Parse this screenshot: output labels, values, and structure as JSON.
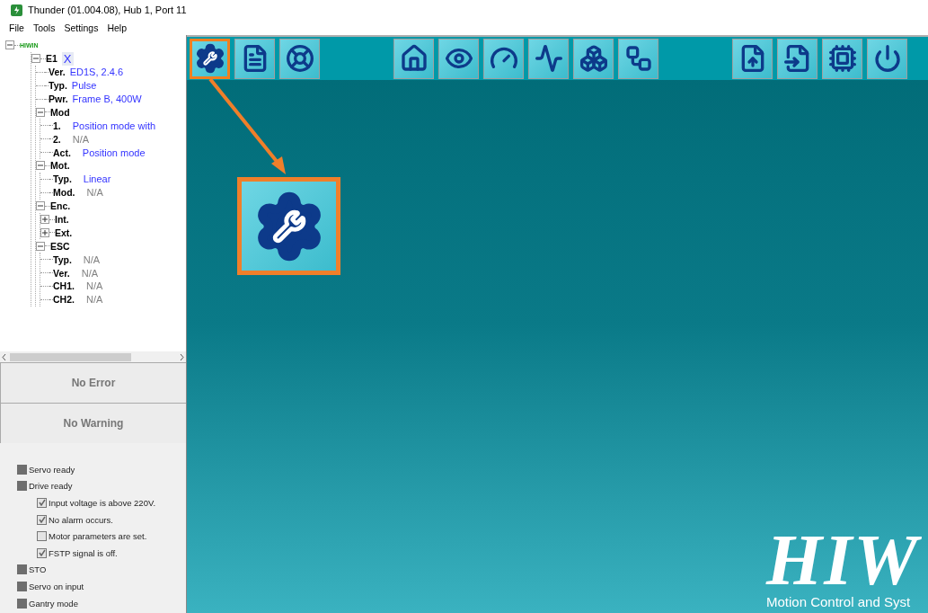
{
  "window": {
    "title": "Thunder (01.004.08), Hub 1, Port 11"
  },
  "menu": [
    "File",
    "Tools",
    "Settings",
    "Help"
  ],
  "tree": [
    {
      "label": "HIWIN",
      "kind": "root",
      "expanded": true,
      "children": [
        {
          "label": "E1",
          "value": "X",
          "color": "#3333ff",
          "expanded": true,
          "children": [
            {
              "label": "Ver.",
              "value": "ED1S, 2.4.6",
              "color": "#3333ff"
            },
            {
              "label": "Typ.",
              "value": "Pulse",
              "color": "#3333ff"
            },
            {
              "label": "Pwr.",
              "value": "Frame B, 400W",
              "color": "#3333ff"
            },
            {
              "label": "Mod",
              "expanded": true,
              "children": [
                {
                  "label": "1.",
                  "value": "Position mode with",
                  "color": "#3333ff"
                },
                {
                  "label": "2.",
                  "value": "N/A",
                  "color": "#808080"
                },
                {
                  "label": "Act.",
                  "value": "Position mode",
                  "color": "#3333ff"
                }
              ]
            },
            {
              "label": "Mot.",
              "expanded": true,
              "children": [
                {
                  "label": "Typ.",
                  "value": "Linear",
                  "color": "#3333ff"
                },
                {
                  "label": "Mod.",
                  "value": "N/A",
                  "color": "#808080"
                }
              ]
            },
            {
              "label": "Enc.",
              "expanded": true,
              "children": [
                {
                  "label": "Int.",
                  "expanded": false
                },
                {
                  "label": "Ext.",
                  "expanded": false
                }
              ]
            },
            {
              "label": "ESC",
              "expanded": true,
              "children": [
                {
                  "label": "Typ.",
                  "value": "N/A",
                  "color": "#808080"
                },
                {
                  "label": "Ver.",
                  "value": "N/A",
                  "color": "#808080"
                },
                {
                  "label": "CH1.",
                  "value": "N/A",
                  "color": "#808080"
                },
                {
                  "label": "CH2.",
                  "value": "N/A",
                  "color": "#808080"
                }
              ]
            }
          ]
        }
      ]
    }
  ],
  "error": "No Error",
  "warning": "No Warning",
  "status": [
    {
      "kind": "lamp",
      "label": "Servo ready",
      "on": false
    },
    {
      "kind": "lamp",
      "label": "Drive ready",
      "on": false
    },
    {
      "kind": "check",
      "label": "Input voltage is above 220V.",
      "checked": true
    },
    {
      "kind": "check",
      "label": "No alarm occurs.",
      "checked": true
    },
    {
      "kind": "check",
      "label": "Motor parameters are set.",
      "checked": false
    },
    {
      "kind": "check",
      "label": "FSTP signal is off.",
      "checked": true
    },
    {
      "kind": "lamp",
      "label": "STO",
      "on": false
    },
    {
      "kind": "lamp",
      "label": "Servo on input",
      "on": false
    },
    {
      "kind": "lamp",
      "label": "Gantry mode",
      "on": false
    }
  ],
  "toolbar": [
    [
      {
        "selected": true
      },
      {
        "selected": false
      },
      {
        "selected": false
      }
    ],
    [
      {
        "selected": false
      },
      {
        "selected": false
      },
      {
        "selected": false
      },
      {
        "selected": false
      },
      {
        "selected": false
      },
      {
        "selected": false
      }
    ],
    [
      {
        "selected": false
      },
      {
        "selected": false
      },
      {
        "selected": false
      },
      {
        "selected": false
      }
    ]
  ],
  "logo": {
    "name": "HIW",
    "tagline": "Motion Control and Syst"
  }
}
